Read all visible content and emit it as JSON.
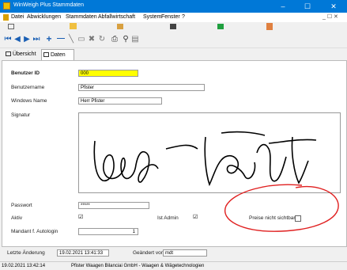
{
  "window": {
    "title": "WinWeigh Plus Stammdaten",
    "minimize": "–",
    "maximize": "☐",
    "close": "✕"
  },
  "menu": {
    "items": [
      "Datei",
      "Abwicklungen",
      "Stammdaten",
      "Abfallwirtschaft",
      "System",
      "Fenster",
      "?"
    ],
    "mdi_controls": "_ ☐ ✕"
  },
  "tabs": [
    {
      "label": "Übersicht"
    },
    {
      "label": "Daten"
    }
  ],
  "form": {
    "benutzer_id": {
      "label": "Benutzer ID",
      "value": "000"
    },
    "benutzername": {
      "label": "Benutzername",
      "value": "Pfister"
    },
    "windows_name": {
      "label": "Windows Name",
      "value": "Herr Pfister"
    },
    "signatur": {
      "label": "Signatur"
    },
    "passwort": {
      "label": "Passwort",
      "value": "*****"
    },
    "aktiv": {
      "label": "Aktiv",
      "checked": true
    },
    "ist_admin": {
      "label": "Ist Admin",
      "checked": true
    },
    "preise_nicht_sichtbar": {
      "label": "Preise nicht sichtbar",
      "checked": false
    },
    "mandant": {
      "label": "Mandant f. Autologin",
      "value": "1"
    }
  },
  "footer": {
    "letzte_aenderung_label": "Letzte Änderung",
    "letzte_aenderung_value": "19.02.2021 13:41:33",
    "geaendert_von_label": "Geändert von",
    "geaendert_von_value": "mdt"
  },
  "status": {
    "datetime": "19.02.2021 13:42:14",
    "company": "Pfister Waagen Bilanciai GmbH - Waagen & Wägetechnologien"
  },
  "colors": {
    "titlebar": "#0078d7",
    "highlight_field": "#ffff00",
    "annotation_circle": "#e02020"
  }
}
